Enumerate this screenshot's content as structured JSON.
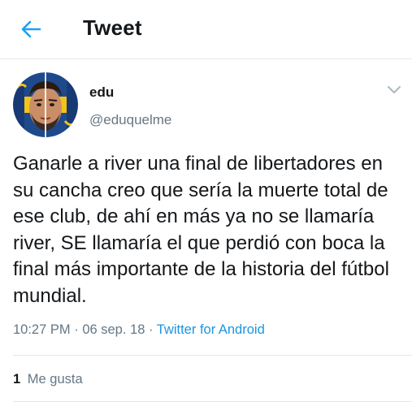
{
  "header": {
    "back_icon": "arrow-left-icon",
    "title": "Tweet",
    "accent": "#1da1f2"
  },
  "tweet": {
    "author": {
      "name": "edu",
      "handle": "@eduquelme",
      "avatar_icon": "avatar-photo"
    },
    "menu_icon": "chevron-down-icon",
    "text": "Ganarle a river una final de libertadores en su cancha creo que sería la muerte total de ese club, de ahí en más ya no se llamaría river, SE llamaría el que perdió con boca la final más importante de la historia del fútbol mundial.",
    "time": "10:27 PM",
    "separator": "·",
    "date": "06 sep. 18",
    "source": "Twitter for Android",
    "source_color": "#1b95e0"
  },
  "stats": {
    "likes_count": "1",
    "likes_label": "Me gusta"
  }
}
